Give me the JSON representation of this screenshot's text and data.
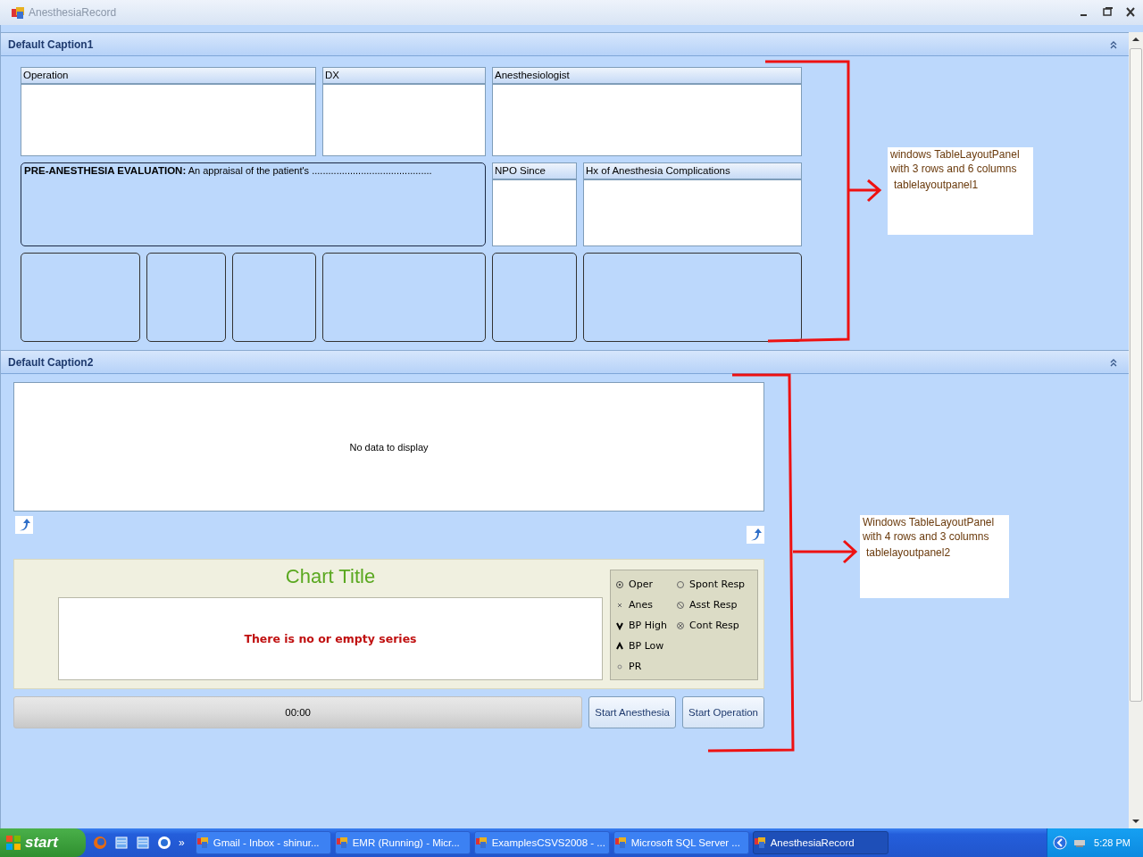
{
  "window": {
    "title": "AnesthesiaRecord"
  },
  "section_1": {
    "caption": "Default Caption1",
    "fields": [
      {
        "label": "Operation"
      },
      {
        "label": "DX"
      },
      {
        "label": "Anesthesiologist"
      },
      {
        "label": "NPO Since"
      },
      {
        "label": "Hx of Anesthesia Complications"
      }
    ],
    "evaluation": "**PRE-ANESTHESIA EVALUATION:** An appraisal of the patient's ............................................"
  },
  "section_2": {
    "caption": "Default Caption2",
    "grid": {
      "empty_text": "No data to display"
    },
    "chart": {
      "title": "Chart Title",
      "message": "There is no or empty series",
      "legend": [
        {
          "label": "Oper",
          "kind": "dot-circle"
        },
        {
          "label": "Anes",
          "kind": "cross"
        },
        {
          "label": "BP High",
          "kind": "down"
        },
        {
          "label": "BP Low",
          "kind": "up"
        },
        {
          "label": "PR",
          "kind": "small-circle"
        },
        {
          "label": "Spont Resp",
          "kind": "circle"
        },
        {
          "label": "Asst Resp",
          "kind": "slash-circle"
        },
        {
          "label": "Cont Resp",
          "kind": "x-circle"
        }
      ]
    },
    "timer": "00:00",
    "buttons": [
      "Start Anesthesia",
      "Start Operation"
    ]
  },
  "annotations": [
    {
      "lines": [
        "windows TableLayoutPanel",
        "with 3 rows and 6 columns",
        "tablelayoutpanel1"
      ]
    },
    {
      "lines": [
        "Windows TableLayoutPanel",
        "with 4 rows and 3 columns",
        "tablelayoutpanel2"
      ]
    }
  ],
  "taskbar": {
    "start": "start",
    "overflow": "»",
    "tasks": [
      {
        "label": "Gmail - Inbox - shinur...",
        "selected": false
      },
      {
        "label": "EMR (Running) - Micr...",
        "selected": false
      },
      {
        "label": "ExamplesCSVS2008 - ...",
        "selected": false
      },
      {
        "label": "Microsoft SQL Server ...",
        "selected": false
      },
      {
        "label": "AnesthesiaRecord",
        "selected": true
      }
    ],
    "clock": "5:28 PM"
  }
}
